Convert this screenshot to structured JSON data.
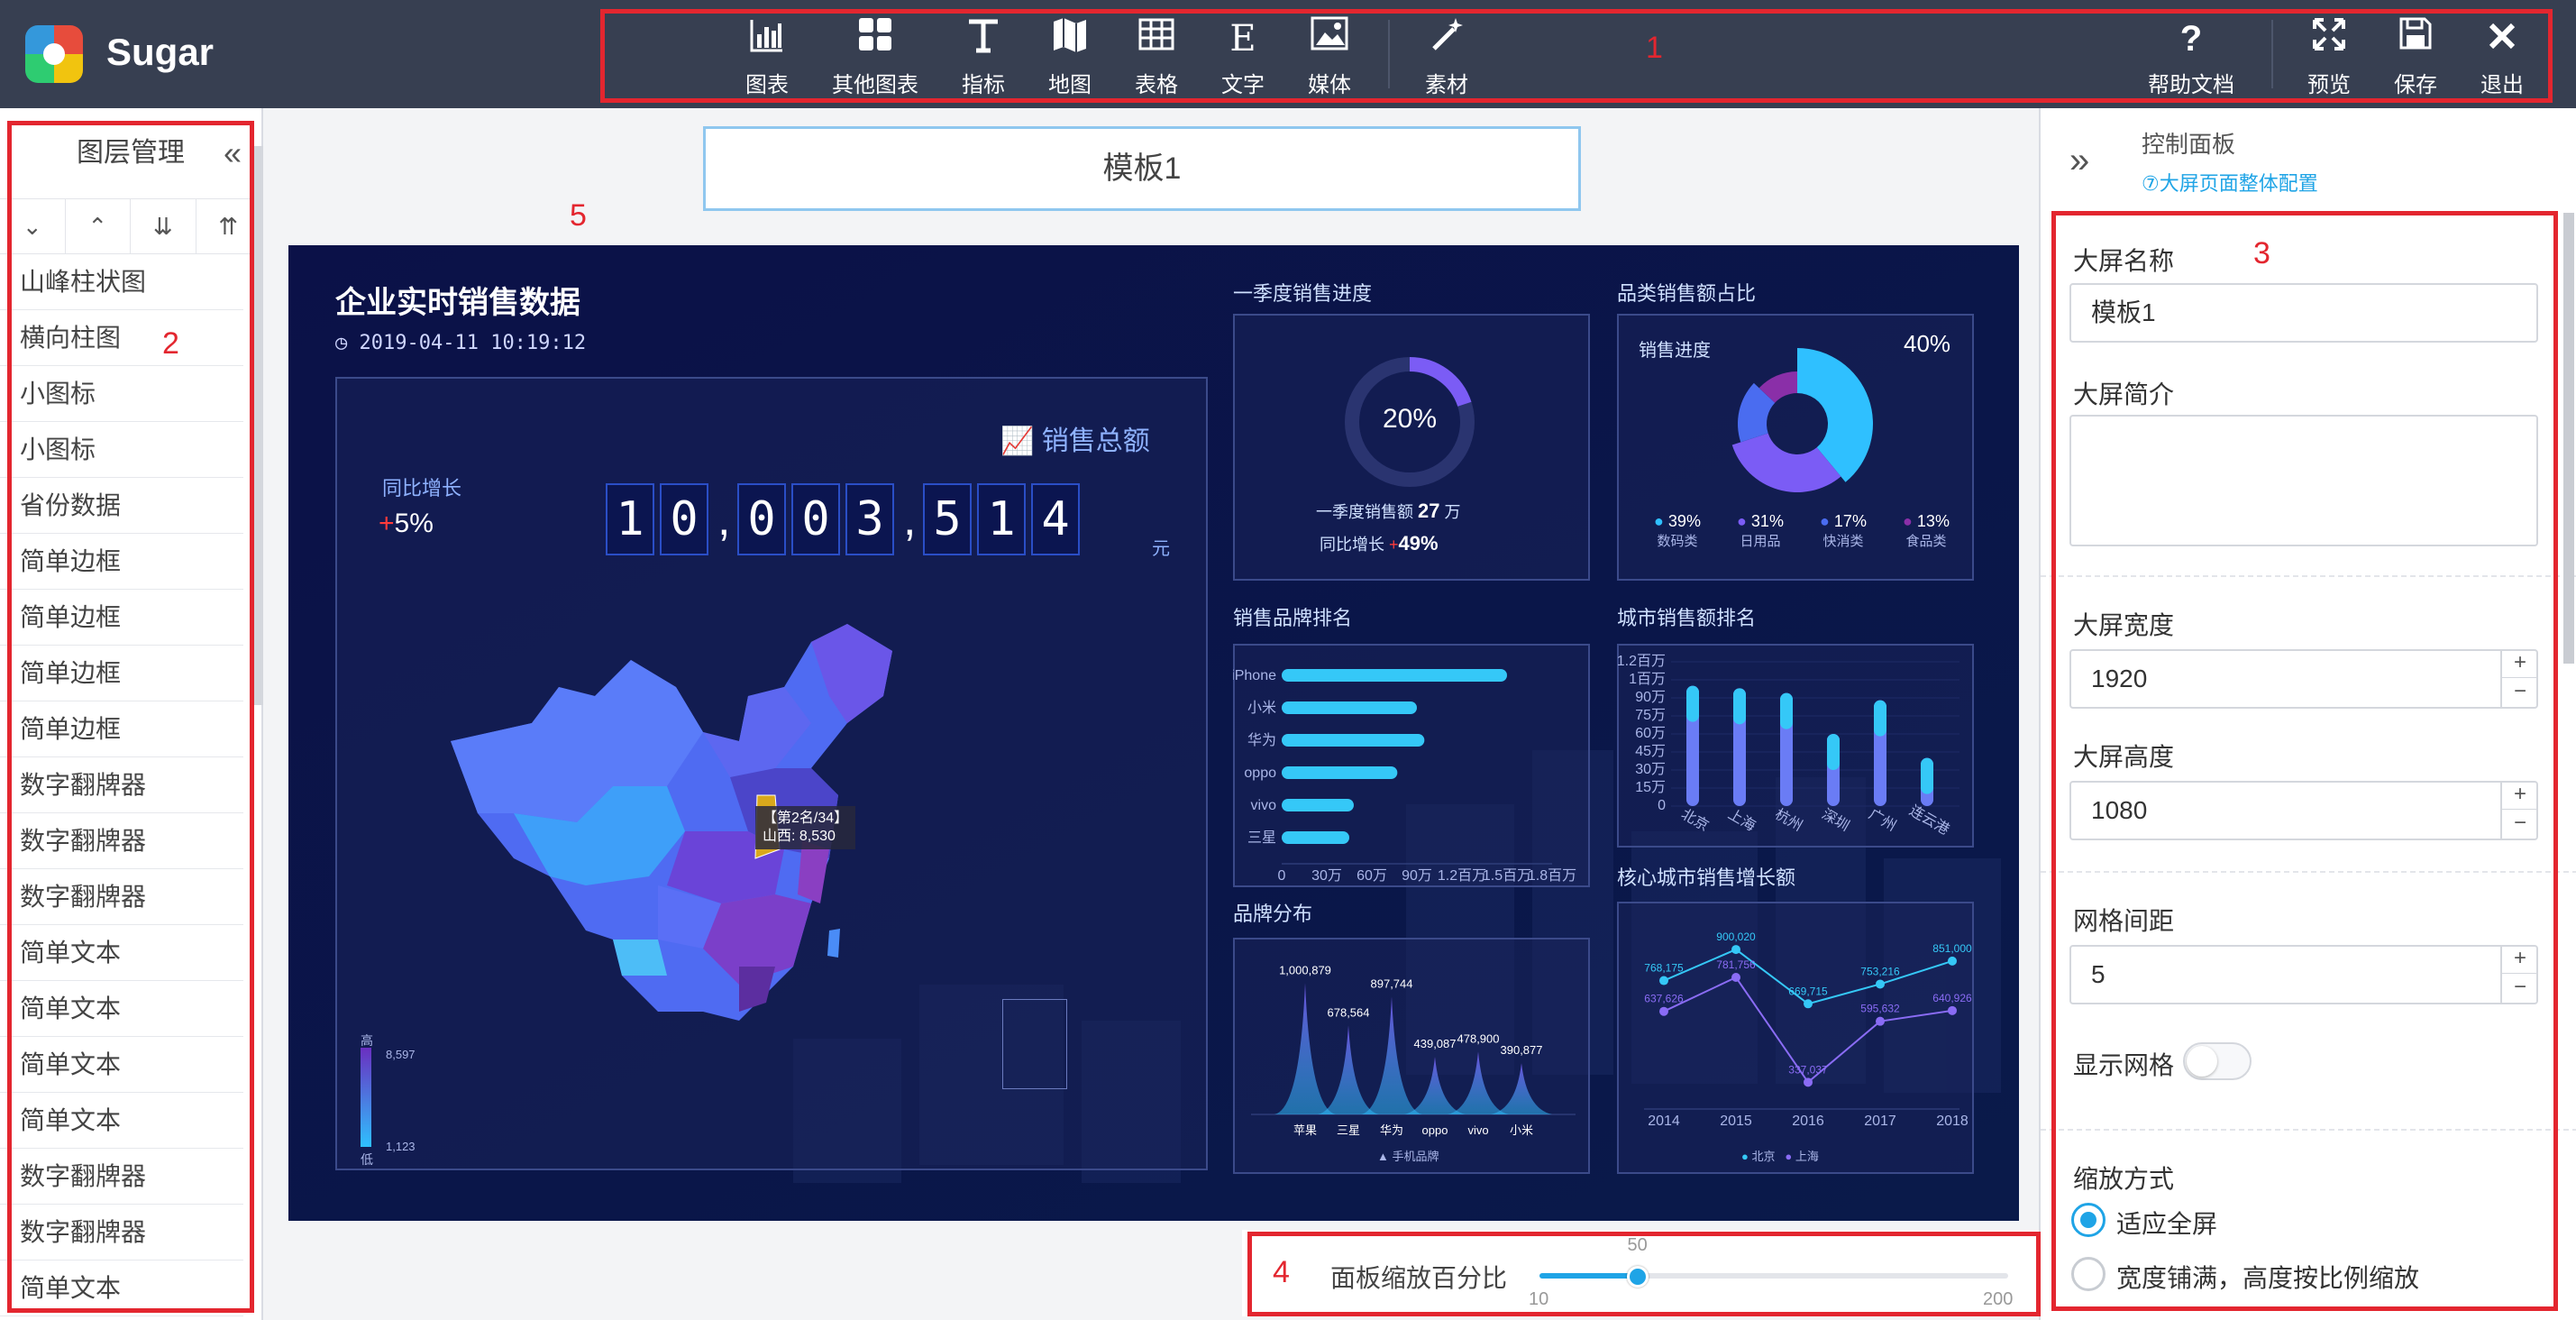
{
  "app": {
    "name": "Sugar"
  },
  "toolbar": {
    "items": [
      {
        "label": "图表",
        "icon": "bar-chart-icon"
      },
      {
        "label": "其他图表",
        "icon": "grid-icon"
      },
      {
        "label": "指标",
        "icon": "text-t-icon"
      },
      {
        "label": "地图",
        "icon": "map-icon"
      },
      {
        "label": "表格",
        "icon": "table-icon"
      },
      {
        "label": "文字",
        "icon": "letter-e-icon"
      },
      {
        "label": "媒体",
        "icon": "image-icon"
      },
      {
        "label": "素材",
        "icon": "magic-wand-icon"
      }
    ],
    "right": [
      {
        "label": "帮助文档",
        "icon": "question-icon"
      },
      {
        "label": "预览",
        "icon": "fullscreen-icon"
      },
      {
        "label": "保存",
        "icon": "save-icon"
      },
      {
        "label": "退出",
        "icon": "close-icon"
      }
    ]
  },
  "annotations": {
    "n1": "1",
    "n2": "2",
    "n3": "3",
    "n4": "4",
    "n5": "5"
  },
  "layers": {
    "title": "图层管理",
    "items": [
      "山峰柱状图",
      "横向柱图",
      "小图标",
      "小图标",
      "省份数据",
      "简单边框",
      "简单边框",
      "简单边框",
      "简单边框",
      "数字翻牌器",
      "数字翻牌器",
      "数字翻牌器",
      "简单文本",
      "简单文本",
      "简单文本",
      "简单文本",
      "数字翻牌器",
      "数字翻牌器",
      "简单文本"
    ]
  },
  "template_name": "模板1",
  "dashboard": {
    "title": "企业实时销售数据",
    "time": "2019-04-11 10:19:12",
    "total_label": "销售总额",
    "yoy_label": "同比增长",
    "yoy_value": "5%",
    "digits": [
      "1",
      "0",
      ",",
      "0",
      "0",
      "3",
      ",",
      "5",
      "1",
      "4"
    ],
    "unit": "元",
    "map_tooltip_1": "【第2名/34】",
    "map_tooltip_2": "山西: 8,530",
    "map_province": "山西",
    "legend_high": "高",
    "legend_low": "低",
    "legend_max": "8,597",
    "legend_min": "1,123",
    "q1": {
      "title": "一季度销售进度",
      "pct": "20%",
      "amount_label": "一季度销售额",
      "amount": "27",
      "amount_unit": "万",
      "yoy_label": "同比增长",
      "yoy": "49%"
    },
    "category": {
      "title": "品类销售额占比",
      "progress_label": "销售进度",
      "progress": "40%",
      "items": [
        {
          "pct": "39%",
          "name": "数码类"
        },
        {
          "pct": "31%",
          "name": "日用品"
        },
        {
          "pct": "17%",
          "name": "快消类"
        },
        {
          "pct": "13%",
          "name": "食品类"
        }
      ]
    },
    "brand_rank": {
      "title": "销售品牌排名"
    },
    "city_rank": {
      "title": "城市销售额排名"
    },
    "brand_dist": {
      "title": "品牌分布",
      "legend": "手机品牌"
    },
    "core_city": {
      "title": "核心城市销售增长额",
      "legend": [
        "北京",
        "上海"
      ]
    }
  },
  "chart_data": [
    {
      "type": "pie",
      "title": "一季度销售进度",
      "values": [
        20,
        80
      ]
    },
    {
      "type": "pie",
      "title": "品类销售额占比",
      "categories": [
        "数码类",
        "日用品",
        "快消类",
        "食品类"
      ],
      "values": [
        39,
        31,
        17,
        13
      ]
    },
    {
      "type": "bar",
      "title": "销售品牌排名",
      "orientation": "horizontal",
      "categories": [
        "iPhone",
        "小米",
        "华为",
        "oppo",
        "vivo",
        "三星"
      ],
      "values": [
        1500000,
        900000,
        950000,
        770000,
        480000,
        450000
      ],
      "xticks": [
        "0",
        "30万",
        "60万",
        "90万",
        "1.2百万",
        "1.5百万",
        "1.8百万"
      ]
    },
    {
      "type": "bar",
      "title": "城市销售额排名",
      "categories": [
        "北京",
        "上海",
        "杭州",
        "深圳",
        "广州",
        "连云港"
      ],
      "values": [
        1000000,
        980000,
        940000,
        600000,
        880000,
        400000
      ],
      "yticks": [
        "0",
        "15万",
        "30万",
        "45万",
        "60万",
        "75万",
        "90万",
        "1百万",
        "1.2百万"
      ]
    },
    {
      "type": "area",
      "title": "品牌分布",
      "categories": [
        "苹果",
        "三星",
        "华为",
        "oppo",
        "vivo",
        "小米"
      ],
      "values": [
        1000879,
        678564,
        897744,
        439087,
        478900,
        390877
      ],
      "labels": [
        "1,000,879",
        "678,564",
        "897,744",
        "439,087",
        "478,900",
        "390,877"
      ],
      "series": [
        {
          "name": "手机品牌",
          "values": [
            1000879,
            678564,
            897744,
            439087,
            478900,
            390877
          ]
        }
      ]
    },
    {
      "type": "line",
      "title": "核心城市销售增长额",
      "x": [
        "2014",
        "2015",
        "2016",
        "2017",
        "2018"
      ],
      "series": [
        {
          "name": "北京",
          "values": [
            768175,
            900020,
            669715,
            753216,
            851000
          ],
          "labels": [
            "768,175",
            "900,020",
            "669,715",
            "753,216",
            "851,000"
          ]
        },
        {
          "name": "上海",
          "values": [
            637626,
            781756,
            337037,
            595632,
            640926
          ],
          "labels": [
            "637,626",
            "781,756",
            "337,037",
            "595,632",
            "640,926"
          ]
        }
      ]
    }
  ],
  "zoom": {
    "label": "面板缩放百分比",
    "value": 50,
    "value_label": "50",
    "min": "10",
    "max": "200"
  },
  "control": {
    "title": "控制面板",
    "link": "⑦大屏页面整体配置",
    "name_label": "大屏名称",
    "name_value": "模板1",
    "desc_label": "大屏简介",
    "width_label": "大屏宽度",
    "width_value": "1920",
    "height_label": "大屏高度",
    "height_value": "1080",
    "grid_label": "网格间距",
    "grid_value": "5",
    "show_grid_label": "显示网格",
    "scale_label": "缩放方式",
    "scale_options": [
      "适应全屏",
      "宽度铺满，高度按比例缩放"
    ]
  },
  "colors": {
    "accent": "#1fa4e6",
    "topbar": "#373f51",
    "annotation": "#e3262f",
    "canvas": "#0a0f3c"
  }
}
